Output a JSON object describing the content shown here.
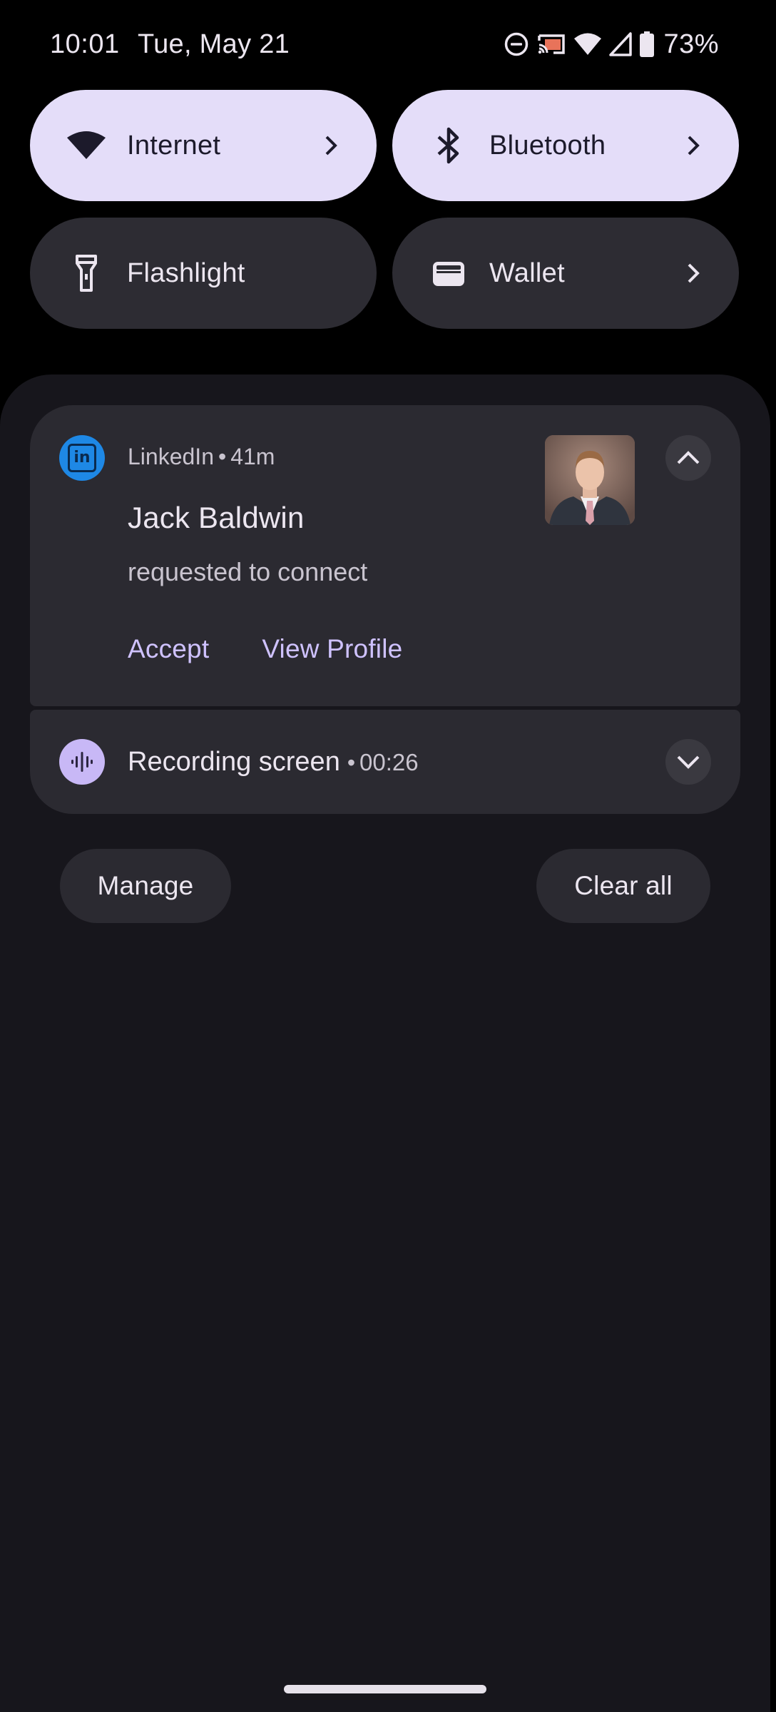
{
  "status_bar": {
    "time": "10:01",
    "date": "Tue, May 21",
    "battery_percent": "73%",
    "icons": [
      "do-not-disturb-icon",
      "cast-icon",
      "wifi-icon",
      "cell-signal-icon",
      "battery-icon"
    ]
  },
  "quick_settings": {
    "tiles": [
      {
        "label": "Internet",
        "icon": "wifi-icon",
        "active": true,
        "has_chevron": true
      },
      {
        "label": "Bluetooth",
        "icon": "bluetooth-icon",
        "active": true,
        "has_chevron": true
      },
      {
        "label": "Flashlight",
        "icon": "flashlight-icon",
        "active": false,
        "has_chevron": false
      },
      {
        "label": "Wallet",
        "icon": "wallet-icon",
        "active": false,
        "has_chevron": true
      }
    ]
  },
  "notifications": {
    "linkedin": {
      "app_name": "LinkedIn",
      "separator": "•",
      "age": "41m",
      "title": "Jack Baldwin",
      "body": "requested to connect",
      "actions": [
        "Accept",
        "View Profile"
      ],
      "icon": "linkedin-icon",
      "expanded": true
    },
    "recording": {
      "title": "Recording screen",
      "separator": "•",
      "elapsed": "00:26",
      "icon": "sound-wave-icon",
      "expanded": false
    }
  },
  "footer_buttons": {
    "manage": "Manage",
    "clear_all": "Clear all"
  },
  "colors": {
    "shade_background": "#17161C",
    "card_background": "#2B2A31",
    "active_tile": "#E4DDF9",
    "inactive_tile": "#2D2C33",
    "action_text": "#CFC2FF",
    "linkedin_blue": "#1E88E5"
  }
}
